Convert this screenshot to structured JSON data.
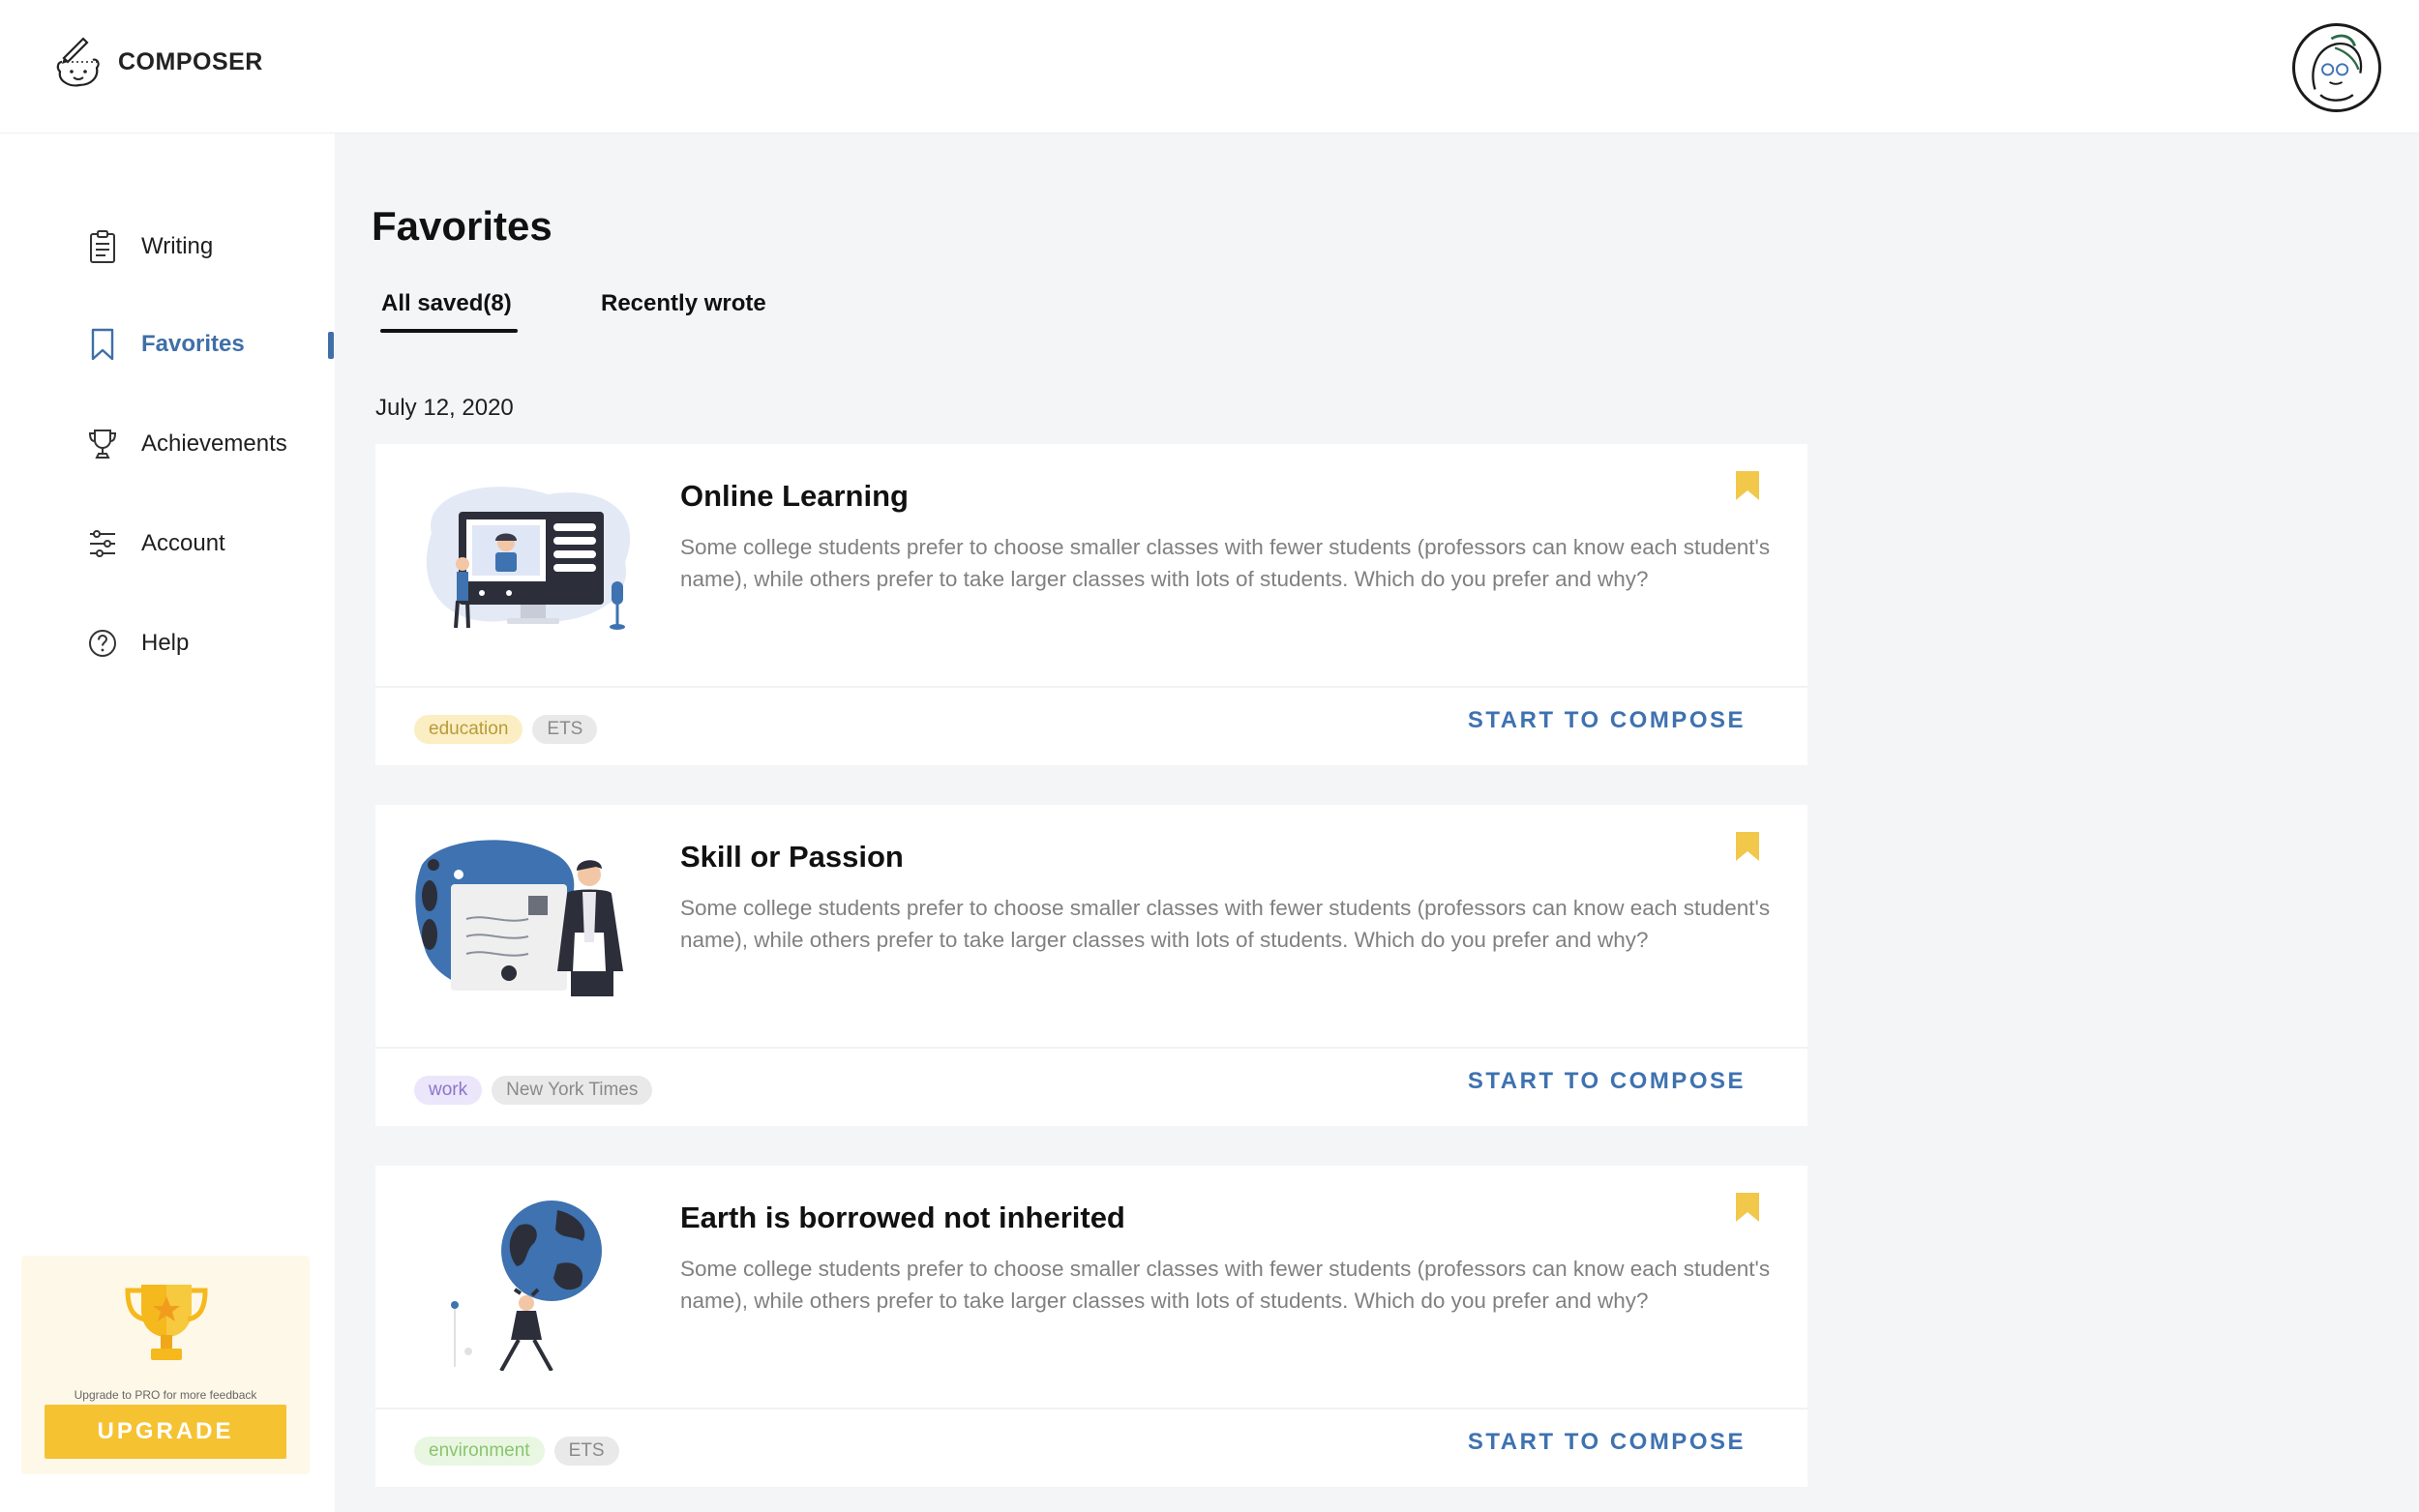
{
  "app": {
    "name": "COMPOSER"
  },
  "sidebar": {
    "items": [
      {
        "label": "Writing",
        "icon": "clipboard-icon"
      },
      {
        "label": "Favorites",
        "icon": "bookmark-icon",
        "active": true
      },
      {
        "label": "Achievements",
        "icon": "trophy-icon"
      },
      {
        "label": "Account",
        "icon": "sliders-icon"
      },
      {
        "label": "Help",
        "icon": "help-circle-icon"
      }
    ],
    "upgrade": {
      "note": "Upgrade to PRO for more feedback",
      "button": "UPGRADE"
    }
  },
  "main": {
    "title": "Favorites",
    "tabs": [
      {
        "label": "All saved(8)",
        "active": true
      },
      {
        "label": "Recently wrote",
        "active": false
      }
    ],
    "date": "July 12, 2020",
    "cards": [
      {
        "title": "Online Learning",
        "description": "Some college students prefer to choose smaller classes with fewer students (professors can know each student's name), while others prefer to take larger classes with lots of students. Which do you prefer and why?",
        "tags": [
          {
            "label": "education",
            "bg": "#fbeec3",
            "fg": "#b99a3a"
          },
          {
            "label": "ETS",
            "bg": "#e9e9e9",
            "fg": "#8a8a8a"
          }
        ],
        "action": "START TO COMPOSE"
      },
      {
        "title": "Skill or Passion",
        "description": "Some college students prefer to choose smaller classes with fewer students (professors can know each student's name), while others prefer to take larger classes with lots of students. Which do you prefer and why?",
        "tags": [
          {
            "label": "work",
            "bg": "#ece6fb",
            "fg": "#8a76c9"
          },
          {
            "label": "New York Times",
            "bg": "#e9e9e9",
            "fg": "#8a8a8a"
          }
        ],
        "action": "START TO COMPOSE"
      },
      {
        "title": "Earth is borrowed not inherited",
        "description": "Some college students prefer to choose smaller classes with fewer students (professors can know each student's name), while others prefer to take larger classes with lots of students. Which do you prefer and why?",
        "tags": [
          {
            "label": "environment",
            "bg": "#e9f7e2",
            "fg": "#8ac46d"
          },
          {
            "label": "ETS",
            "bg": "#e9e9e9",
            "fg": "#8a8a8a"
          }
        ],
        "action": "START TO COMPOSE"
      }
    ]
  },
  "colors": {
    "accent": "#3f6fa7",
    "bookmark": "#f2c84b",
    "upgrade": "#f5c232",
    "background": "#f4f5f7"
  }
}
